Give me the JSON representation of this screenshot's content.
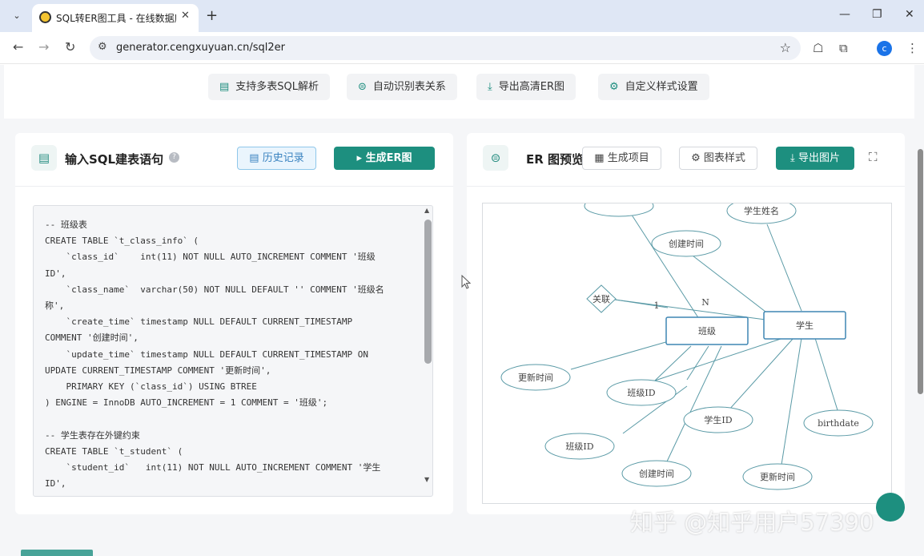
{
  "browser": {
    "tab_title": "SQL转ER图工具 - 在线数据库设",
    "url": "generator.cengxuyuan.cn/sql2er",
    "profile_initial": "c"
  },
  "features": [
    {
      "label": "支持多表SQL解析",
      "icon": "document-icon"
    },
    {
      "label": "自动识别表关系",
      "icon": "link-icon"
    },
    {
      "label": "导出高清ER图",
      "icon": "download-icon"
    },
    {
      "label": "自定义样式设置",
      "icon": "gear-icon"
    }
  ],
  "left_panel": {
    "title": "输入SQL建表语句",
    "history_label": "历史记录",
    "generate_label": "生成ER图",
    "sql_text": "-- 班级表\nCREATE TABLE `t_class_info` (\n    `class_id`    int(11) NOT NULL AUTO_INCREMENT COMMENT '班级\nID',\n    `class_name`  varchar(50) NOT NULL DEFAULT '' COMMENT '班级名\n称',\n    `create_time` timestamp NULL DEFAULT CURRENT_TIMESTAMP\nCOMMENT '创建时间',\n    `update_time` timestamp NULL DEFAULT CURRENT_TIMESTAMP ON\nUPDATE CURRENT_TIMESTAMP COMMENT '更新时间',\n    PRIMARY KEY (`class_id`) USING BTREE\n) ENGINE = InnoDB AUTO_INCREMENT = 1 COMMENT = '班级';\n\n-- 学生表存在外键约束\nCREATE TABLE `t_student` (\n    `student_id`   int(11) NOT NULL AUTO_INCREMENT COMMENT '学生\nID',"
  },
  "right_panel": {
    "title": "ER 图预览",
    "project_label": "生成项目",
    "style_label": "图表样式",
    "export_label": "导出图片"
  },
  "er": {
    "entities": [
      "班级",
      "学生"
    ],
    "relation": "关联",
    "cardinality_1": "1",
    "cardinality_n": "N",
    "attributes": [
      "学生姓名",
      "创建时间",
      "更新时间",
      "班级ID",
      "学生ID",
      "birthdate",
      "班级ID",
      "创建时间",
      "更新时间"
    ]
  },
  "watermark": "知乎 @知乎用户57390"
}
